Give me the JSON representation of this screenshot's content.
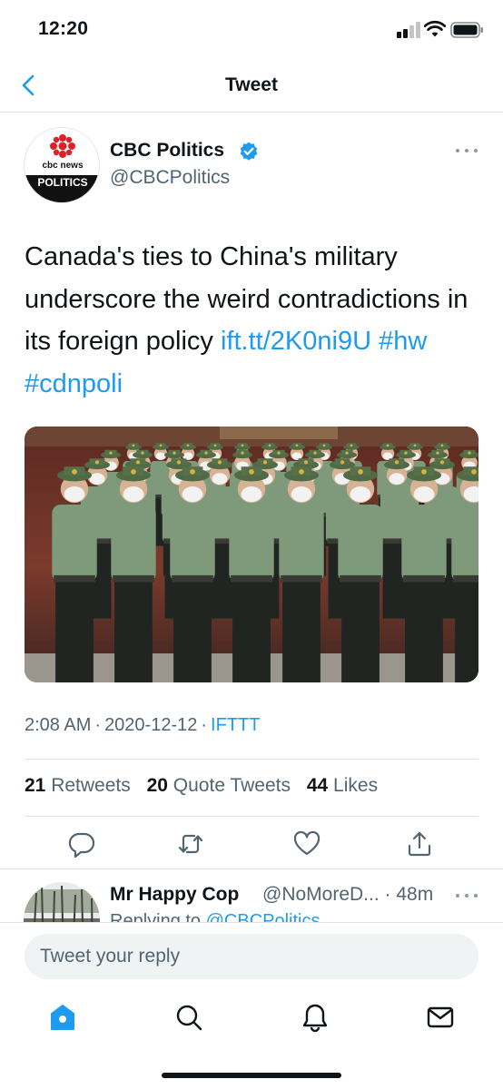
{
  "status_bar": {
    "time": "12:20"
  },
  "nav": {
    "title": "Tweet",
    "back_icon": "chevron-left-icon"
  },
  "tweet": {
    "author_name": "CBC Politics",
    "author_handle": "@CBCPolitics",
    "avatar_brand": "cbc news",
    "avatar_label": "POLITICS",
    "text": "Canada's ties to China's military underscore the weird contradictions in its foreign policy",
    "link": "ift.tt/2K0ni9U",
    "hashtags": [
      "#hw",
      "#cdnpoli"
    ],
    "time": "2:08 AM",
    "date": "2020-12-12",
    "source": "IFTTT",
    "retweets": {
      "count": "21",
      "label": "Retweets"
    },
    "quote_tweets": {
      "count": "20",
      "label": "Quote Tweets"
    },
    "likes": {
      "count": "44",
      "label": "Likes"
    }
  },
  "reply": {
    "author_name": "Mr Happy Cop",
    "author_handle": "@NoMoreD...",
    "age": "48m",
    "replying_prefix": "Replying to",
    "replying_to": "@CBCPolitics"
  },
  "composer": {
    "placeholder": "Tweet your reply"
  },
  "colors": {
    "accent": "#1d9bf0",
    "text": "#0f1419",
    "muted": "#536471",
    "cbc_red": "#e21f26"
  },
  "tab_bar": {
    "items": [
      "home-icon",
      "search-icon",
      "notifications-icon",
      "messages-icon"
    ],
    "active": "home-icon"
  }
}
